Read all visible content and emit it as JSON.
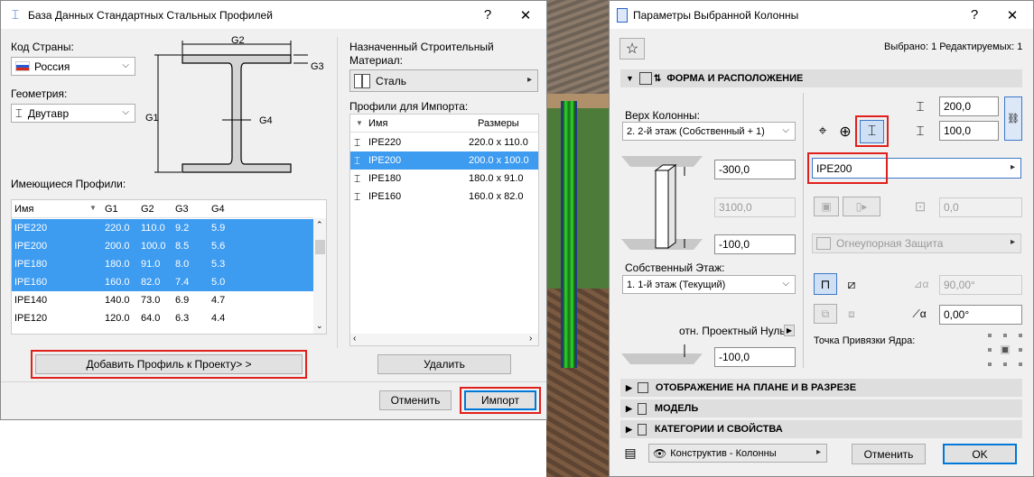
{
  "left_dialog": {
    "title": "База Данных Стандартных Стальных Профилей",
    "help": "?",
    "close": "✕",
    "country_label": "Код Страны:",
    "country_value": "Россия",
    "geometry_label": "Геометрия:",
    "geometry_value": "Двутавр",
    "dims": {
      "g1": "G1",
      "g2": "G2",
      "g3": "G3",
      "g4": "G4"
    },
    "available_label": "Имеющиеся Профили:",
    "columns": [
      "Имя",
      "G1",
      "G2",
      "G3",
      "G4"
    ],
    "rows": [
      {
        "name": "IPE220",
        "g1": "220.0",
        "g2": "110.0",
        "g3": "9.2",
        "g4": "5.9",
        "selected": true
      },
      {
        "name": "IPE200",
        "g1": "200.0",
        "g2": "100.0",
        "g3": "8.5",
        "g4": "5.6",
        "selected": true
      },
      {
        "name": "IPE180",
        "g1": "180.0",
        "g2": "91.0",
        "g3": "8.0",
        "g4": "5.3",
        "selected": true
      },
      {
        "name": "IPE160",
        "g1": "160.0",
        "g2": "82.0",
        "g3": "7.4",
        "g4": "5.0",
        "selected": true
      },
      {
        "name": "IPE140",
        "g1": "140.0",
        "g2": "73.0",
        "g3": "6.9",
        "g4": "4.7",
        "selected": false
      },
      {
        "name": "IPE120",
        "g1": "120.0",
        "g2": "64.0",
        "g3": "6.3",
        "g4": "4.4",
        "selected": false
      }
    ],
    "add_button": "Добавить Профиль к Проекту> >",
    "material_label": "Назначенный Строительный Материал:",
    "material_value": "Сталь",
    "import_label": "Профили для Импорта:",
    "import_columns": [
      "Имя",
      "Размеры"
    ],
    "import_rows": [
      {
        "name": "IPE220",
        "size": "220.0 x 110.0",
        "selected": false
      },
      {
        "name": "IPE200",
        "size": "200.0 x 100.0",
        "selected": true
      },
      {
        "name": "IPE180",
        "size": "180.0 x 91.0",
        "selected": false
      },
      {
        "name": "IPE160",
        "size": "160.0 x 82.0",
        "selected": false
      }
    ],
    "delete_button": "Удалить",
    "cancel_button": "Отменить",
    "import_button": "Импорт"
  },
  "right_dialog": {
    "title": "Параметры Выбранной Колонны",
    "help": "?",
    "close": "✕",
    "status": "Выбрано: 1 Редактируемых: 1",
    "section_shape": "ФОРМА И РАСПОЛОЖЕНИЕ",
    "top_label": "Верх Колонны:",
    "top_value": "2. 2-й этаж (Собственный + 1)",
    "top_offset": "-300,0",
    "height": "3100,0",
    "bottom_offset": "-100,0",
    "home_story_label": "Собственный Этаж:",
    "home_story_value": "1. 1-й этаж (Текущий)",
    "ref_zero_label": "отн. Проектный Нуль",
    "ref_zero_value": "-100,0",
    "width": "200,0",
    "depth": "100,0",
    "profile_value": "IPE200",
    "rotation_field": "0,0",
    "fireproof_label": "Огнеупорная Защита",
    "angle_value": "90,00°",
    "orientation_value": "0,00°",
    "anchor_label": "Точка Привязки Ядра:",
    "section_plan": "ОТОБРАЖЕНИЕ НА ПЛАНЕ И В РАЗРЕЗЕ",
    "section_model": "МОДЕЛЬ",
    "section_categories": "КАТЕГОРИИ И СВОЙСТВА",
    "layer_value": "Конструктив - Колонны",
    "cancel_button": "Отменить",
    "ok_button": "OK"
  }
}
